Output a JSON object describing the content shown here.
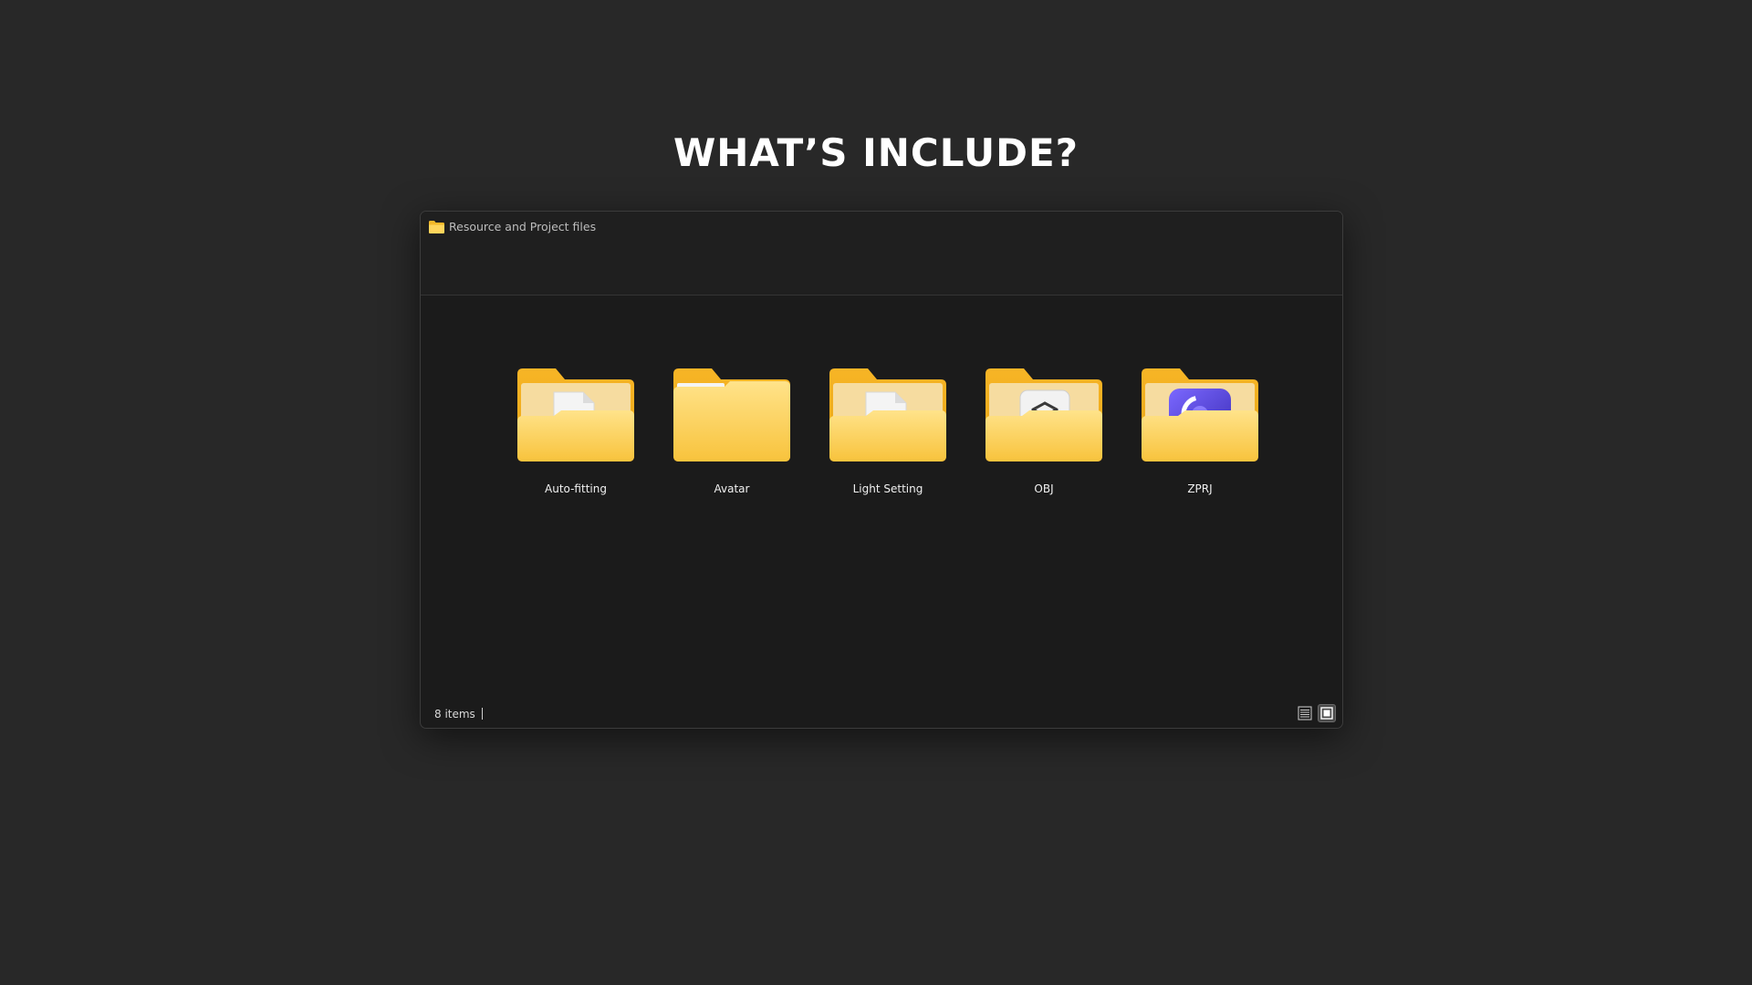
{
  "headline": "WHAT’S INCLUDE?",
  "window": {
    "title": "Resource and Project files",
    "title_icon": "folder-icon"
  },
  "folders": [
    {
      "label": "Auto-fitting",
      "icon": "folder-with-document-icon"
    },
    {
      "label": "Avatar",
      "icon": "folder-icon"
    },
    {
      "label": "Light Setting",
      "icon": "folder-with-document-icon"
    },
    {
      "label": "OBJ",
      "icon": "folder-with-3d-object-icon"
    },
    {
      "label": "ZPRJ",
      "icon": "folder-with-app-icon"
    }
  ],
  "status": {
    "item_count": "8 items",
    "view_details_icon": "details-view-icon",
    "view_tiles_icon": "large-icons-view-icon"
  },
  "colors": {
    "background": "#282828",
    "window_background": "#1b1b1b",
    "folder_back": "#f5b829",
    "folder_front": "#ffd155",
    "app_icon": "#5b3fd6"
  }
}
